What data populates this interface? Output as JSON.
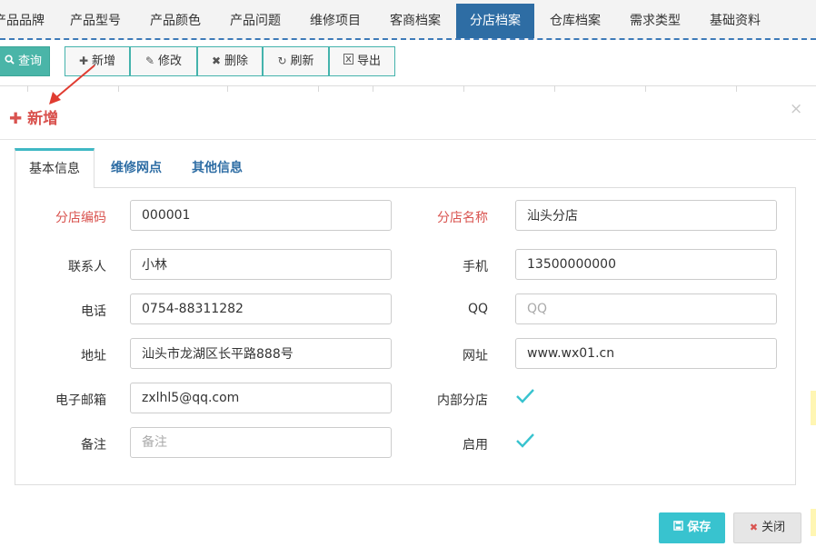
{
  "nav": {
    "tabs": [
      "产品品牌",
      "产品型号",
      "产品颜色",
      "产品问题",
      "维修项目",
      "客商档案",
      "分店档案",
      "仓库档案",
      "需求类型",
      "基础资料"
    ],
    "active_index": 6
  },
  "toolbar": {
    "query": "查询",
    "add": "新增",
    "edit": "修改",
    "delete": "删除",
    "refresh": "刷新",
    "export": "导出"
  },
  "modal": {
    "title": "新增",
    "close_symbol": "×",
    "tabs": [
      "基本信息",
      "维修网点",
      "其他信息"
    ],
    "active_tab": 0,
    "fields": {
      "branch_code": {
        "label": "分店编码",
        "value": "000001",
        "required": true
      },
      "branch_name": {
        "label": "分店名称",
        "value": "汕头分店",
        "required": true
      },
      "contact": {
        "label": "联系人",
        "value": "小林"
      },
      "mobile": {
        "label": "手机",
        "value": "13500000000"
      },
      "phone": {
        "label": "电话",
        "value": "0754-88311282"
      },
      "qq": {
        "label": "QQ",
        "value": "",
        "placeholder": "QQ"
      },
      "address": {
        "label": "地址",
        "value": "汕头市龙湖区长平路888号"
      },
      "website": {
        "label": "网址",
        "value": "www.wx01.cn"
      },
      "email": {
        "label": "电子邮箱",
        "value": "zxlhl5@qq.com"
      },
      "internal_branch": {
        "label": "内部分店",
        "checked": true
      },
      "remark": {
        "label": "备注",
        "value": "",
        "placeholder": "备注"
      },
      "enabled": {
        "label": "启用",
        "checked": true
      }
    },
    "buttons": {
      "save": "保存",
      "close": "关闭"
    }
  },
  "colors": {
    "nav_active": "#2e6da4",
    "accent_teal": "#38c3cf",
    "required_red": "#d9534f",
    "toolbar_border": "#44b3ac"
  }
}
